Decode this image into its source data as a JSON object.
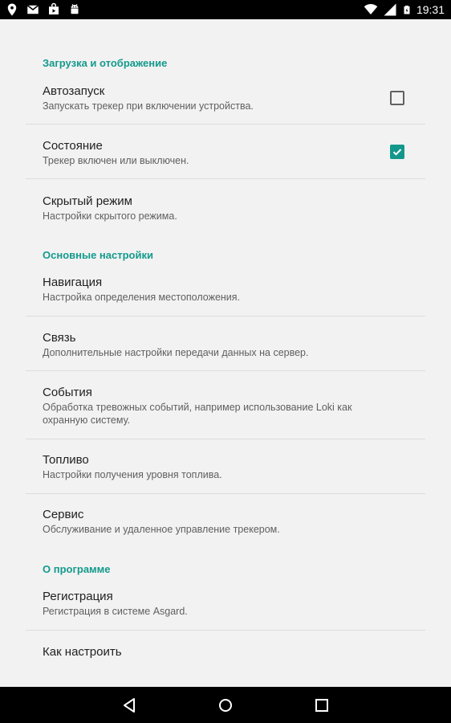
{
  "status_bar": {
    "time": "19:31",
    "left_icons": [
      "location-pin-icon",
      "mail-icon",
      "shopping-bag-icon",
      "android-icon"
    ],
    "right_icons": [
      "wifi-icon",
      "signal-icon",
      "battery-icon"
    ]
  },
  "sections": {
    "loading": {
      "header": "Загрузка и отображение"
    },
    "main": {
      "header": "Основные настройки"
    },
    "about": {
      "header": "О программе"
    }
  },
  "prefs": {
    "autostart": {
      "title": "Автозапуск",
      "summary": "Запускать трекер при включении устройства.",
      "checked": false
    },
    "state": {
      "title": "Состояние",
      "summary": "Трекер включен или выключен.",
      "checked": true
    },
    "hidden": {
      "title": "Скрытый режим",
      "summary": "Настройки скрытого режима."
    },
    "navigation": {
      "title": "Навигация",
      "summary": "Настройка определения местоположения."
    },
    "connection": {
      "title": "Связь",
      "summary": "Дополнительные настройки передачи данных на сервер."
    },
    "events": {
      "title": "События",
      "summary": "Обработка тревожных событий, например использование Loki как охранную систему."
    },
    "fuel": {
      "title": "Топливо",
      "summary": "Настройки получения уровня топлива."
    },
    "service": {
      "title": "Сервис",
      "summary": "Обслуживание и удаленное управление трекером."
    },
    "registration": {
      "title": "Регистрация",
      "summary": "Регистрация в системе Asgard."
    },
    "howto": {
      "title": "Как настроить"
    }
  },
  "colors": {
    "accent": "#149a8c",
    "background": "#f2f2f2",
    "title_text": "#212121",
    "summary_text": "#5f5f5f"
  }
}
